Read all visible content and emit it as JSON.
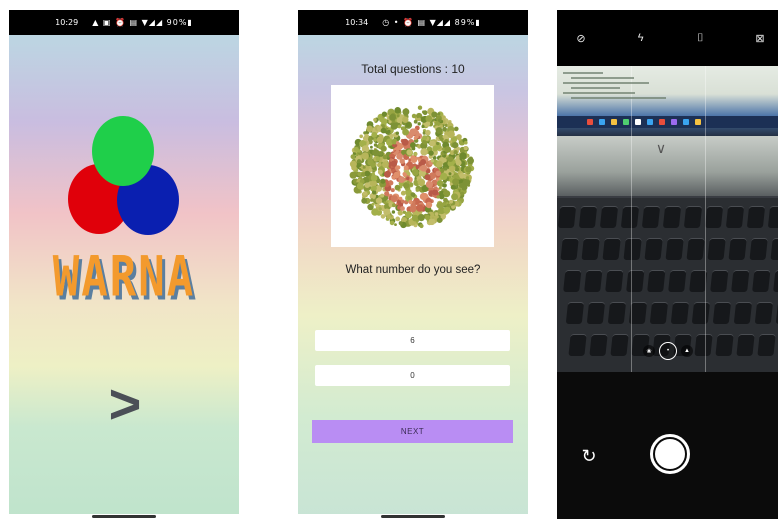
{
  "splash": {
    "status": {
      "time": "10:29",
      "icons": "▲ ▣  ⏰ ▤ ▼◢◢ 90%▮"
    },
    "logo": {
      "text": "WARNA"
    },
    "next_icon": "chevron-right-icon",
    "next_glyph": ">"
  },
  "quiz": {
    "status": {
      "time": "10:34",
      "icons": "◷ •   ⏰ ▤ ▼◢◢ 89%▮"
    },
    "total_label": "Total questions : 10",
    "plate_number": "6",
    "question": "What number do you see?",
    "answers": [
      "6",
      "0"
    ],
    "next_label": "NEXT",
    "colors": {
      "next_bg": "#b98df3"
    }
  },
  "camera": {
    "toolbar_icons": [
      {
        "name": "timer-off-icon",
        "glyph": "⊘"
      },
      {
        "name": "flash-off-icon",
        "glyph": "ϟ"
      },
      {
        "name": "aspect-ratio-icon",
        "glyph": "⌷"
      },
      {
        "name": "hdr-off-icon",
        "glyph": "⊠"
      }
    ],
    "lens_options": [
      "❀",
      "•",
      "▲"
    ],
    "flip_icon": "↻"
  }
}
